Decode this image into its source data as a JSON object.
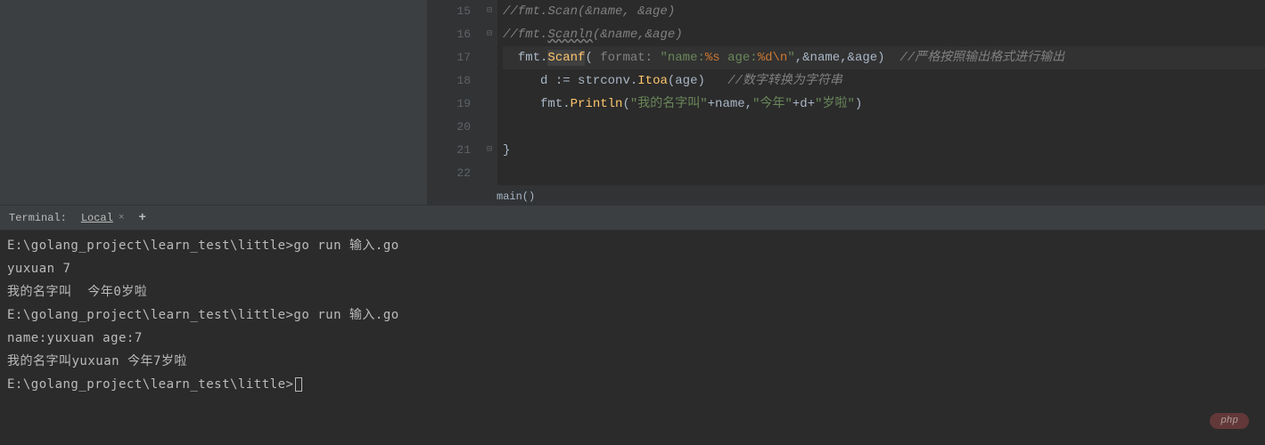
{
  "gutter": {
    "lines": [
      "15",
      "16",
      "17",
      "18",
      "19",
      "20",
      "21",
      "22"
    ]
  },
  "code": {
    "line15": {
      "comment": "//fmt.Scan(&name, &age)"
    },
    "line16": {
      "prefix": "//fmt.",
      "scanln": "Scanln",
      "suffix": "(&name,&age)"
    },
    "line17": {
      "pkg": "fmt.",
      "func": "Scanf",
      "paren_open": "( ",
      "param": "format: ",
      "str1": "\"name:",
      "fmt1": "%s",
      "str2": " age:",
      "fmt2": "%d",
      "esc": "\\n",
      "str3": "\"",
      "args": ",&name,&age)",
      "comment": "  //严格按照输出格式进行输出"
    },
    "line18": {
      "var": "d ",
      "op": ":= ",
      "call": "strconv.",
      "func": "Itoa",
      "args": "(age)",
      "comment": "   //数字转换为字符串"
    },
    "line19": {
      "pkg": "fmt.",
      "func": "Println",
      "paren": "(",
      "str1": "\"我的名字叫\"",
      "plus1": "+name,",
      "str2": "\"今年\"",
      "plus2": "+d+",
      "str3": "\"岁啦\"",
      "close": ")"
    },
    "line21": {
      "brace": "}"
    }
  },
  "breadcrumb": {
    "text": "main()"
  },
  "terminal": {
    "label": "Terminal:",
    "tab": "Local",
    "lines": [
      "E:\\golang_project\\learn_test\\little>go run 输入.go",
      "yuxuan 7",
      "我的名字叫  今年0岁啦",
      "",
      "E:\\golang_project\\learn_test\\little>go run 输入.go",
      "name:yuxuan age:7",
      "我的名字叫yuxuan 今年7岁啦",
      "",
      "E:\\golang_project\\learn_test\\little>"
    ]
  },
  "watermark": "php"
}
